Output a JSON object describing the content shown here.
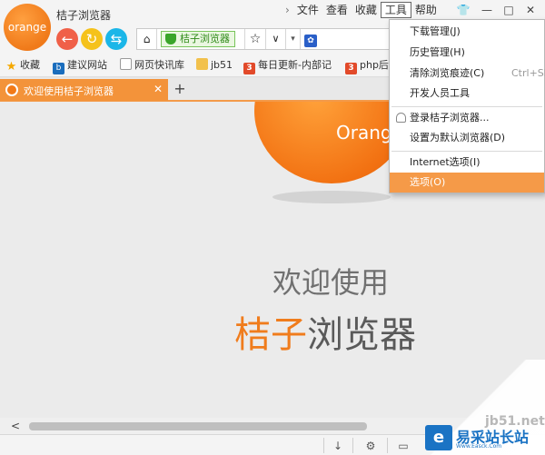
{
  "app": {
    "title": "桔子浏览器",
    "logo_text": "orange"
  },
  "menubar": {
    "items": [
      "文件",
      "查看",
      "收藏",
      "工具",
      "帮助"
    ],
    "active": "工具"
  },
  "window_controls": {
    "shirt": "👕",
    "minimize": "—",
    "maximize": "□",
    "close": "✕"
  },
  "nav": {
    "back": "←",
    "refresh": "↻",
    "home_blue": "⇆"
  },
  "address": {
    "home": "⌂",
    "safe_label": "桔子浏览器",
    "star": "☆",
    "chevron": "∨",
    "caret": "▾",
    "paw": "🐾"
  },
  "bookmarks": [
    {
      "label": "收藏",
      "icon": "star-icon"
    },
    {
      "label": "建议网站",
      "icon": "bing-icon"
    },
    {
      "label": "网页快讯库",
      "icon": "document-icon"
    },
    {
      "label": "jb51",
      "icon": "folder-icon"
    },
    {
      "label": "每日更新-内部记",
      "icon": "3b-logo-icon"
    },
    {
      "label": "php后",
      "icon": "3b-logo-icon"
    }
  ],
  "tab": {
    "title": "欢迎使用桔子浏览器",
    "close": "✕",
    "new_tab": "+"
  },
  "content": {
    "orange_label": "Orange",
    "welcome_line1": "欢迎使用",
    "welcome_highlight": "桔子",
    "welcome_rest": "浏览器"
  },
  "scrollbar": {
    "left_arrow": "<"
  },
  "statusbar": {
    "download": "↓",
    "gear": "⚙",
    "window": "▭"
  },
  "tools_menu": {
    "items": [
      {
        "label": "下载管理(J)"
      },
      {
        "label": "历史管理(H)"
      },
      {
        "label": "清除浏览痕迹(C)",
        "shortcut": "Ctrl+Sh"
      },
      {
        "label": "开发人员工具"
      },
      {
        "label": "登录桔子浏览器..."
      },
      {
        "label": "设置为默认浏览器(D)"
      },
      {
        "label": "Internet选项(I)"
      },
      {
        "label": "选项(O)"
      }
    ],
    "highlighted": "选项(O)"
  },
  "watermark": {
    "url": "jb51.net",
    "badge": "e",
    "name": "易采站长站",
    "sub": "Www.Easck.Com"
  },
  "colors": {
    "accent_orange": "#f3933a",
    "menu_highlight": "#f59a48",
    "safe_green": "#3aa52a",
    "watermark_blue": "#1a73c4"
  }
}
